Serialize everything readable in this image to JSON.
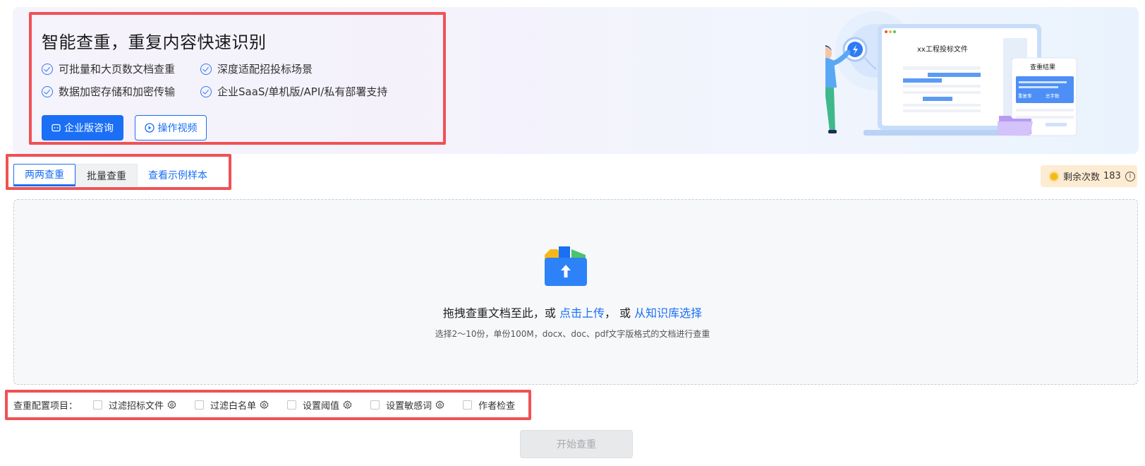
{
  "banner": {
    "title": "智能查重，重复内容快速识别",
    "features": [
      "可批量和大页数文档查重",
      "深度适配招投标场景",
      "数据加密存储和加密传输",
      "企业SaaS/单机版/API/私有部署支持"
    ],
    "primary_button": "企业版咨询",
    "video_button": "操作视频",
    "illustration": {
      "doc_title": "xx工程投标文件",
      "result_title": "查重结果",
      "result_labels": [
        "重复率",
        "总字数"
      ]
    }
  },
  "tabs": [
    {
      "label": "两两查重",
      "active": true
    },
    {
      "label": "批量查重",
      "active": false
    },
    {
      "label": "查看示例样本",
      "active": false
    }
  ],
  "remaining": {
    "label": "剩余次数",
    "count": "183"
  },
  "upload": {
    "prefix": "拖拽查重文档至此，或",
    "upload_link": "点击上传",
    "separator": "，  或",
    "library_link": "从知识库选择",
    "hint": "选择2～10份，单份100M，docx、doc、pdf文字版格式的文档进行查重"
  },
  "config": {
    "label": "查重配置项目：",
    "items": [
      {
        "label": "过滤招标文件",
        "gear": true
      },
      {
        "label": "过滤白名单",
        "gear": true
      },
      {
        "label": "设置阈值",
        "gear": true
      },
      {
        "label": "设置敏感词",
        "gear": true
      },
      {
        "label": "作者检查",
        "gear": false
      }
    ]
  },
  "start_button": "开始查重",
  "colors": {
    "primary": "#1a6ff5",
    "highlight": "#ef5254",
    "remaining_bg": "#fdecd2"
  }
}
